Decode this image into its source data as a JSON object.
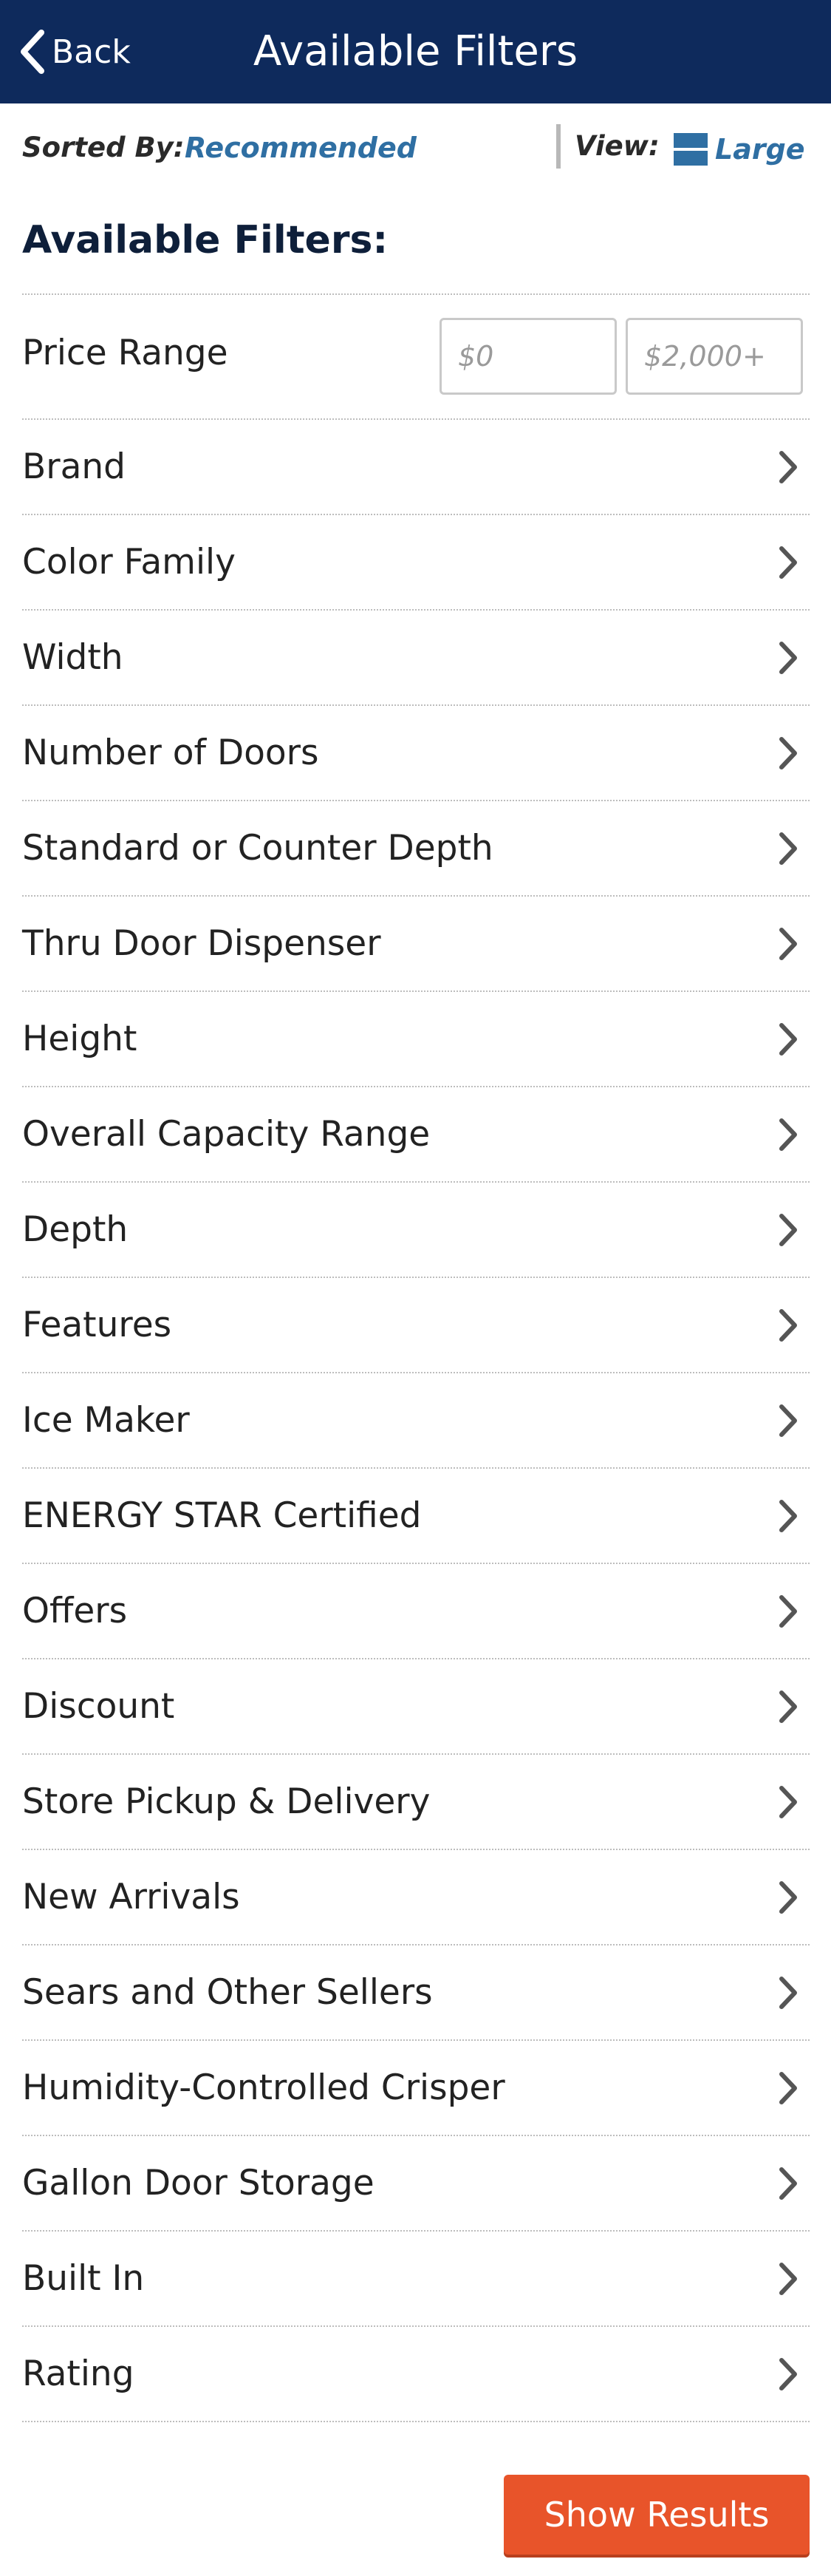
{
  "header": {
    "back_label": "Back",
    "title": "Available Filters"
  },
  "sort": {
    "label": "Sorted By:",
    "value": "Recommended"
  },
  "view": {
    "label": "View:",
    "value": "Large",
    "icon": "list-view-icon",
    "accent": "#2f6fa3"
  },
  "filters_heading": "Available Filters:",
  "price": {
    "label": "Price Range",
    "min_placeholder": "$0",
    "max_placeholder": "$2,000+",
    "min_value": "",
    "max_value": ""
  },
  "filters": [
    {
      "label": "Brand"
    },
    {
      "label": "Color Family"
    },
    {
      "label": "Width"
    },
    {
      "label": "Number of Doors"
    },
    {
      "label": "Standard or Counter Depth"
    },
    {
      "label": "Thru Door Dispenser"
    },
    {
      "label": "Height"
    },
    {
      "label": "Overall Capacity Range"
    },
    {
      "label": "Depth"
    },
    {
      "label": "Features"
    },
    {
      "label": "Ice Maker"
    },
    {
      "label": "ENERGY STAR Certified"
    },
    {
      "label": "Offers"
    },
    {
      "label": "Discount"
    },
    {
      "label": "Store Pickup & Delivery"
    },
    {
      "label": "New Arrivals"
    },
    {
      "label": "Sears and Other Sellers"
    },
    {
      "label": "Humidity-Controlled Crisper"
    },
    {
      "label": "Gallon Door Storage"
    },
    {
      "label": "Built In"
    },
    {
      "label": "Rating"
    }
  ],
  "show_results_label": "Show Results",
  "colors": {
    "header_bg": "#0e2a5c",
    "accent": "#2f6fa3",
    "button_bg": "#e8542a"
  }
}
